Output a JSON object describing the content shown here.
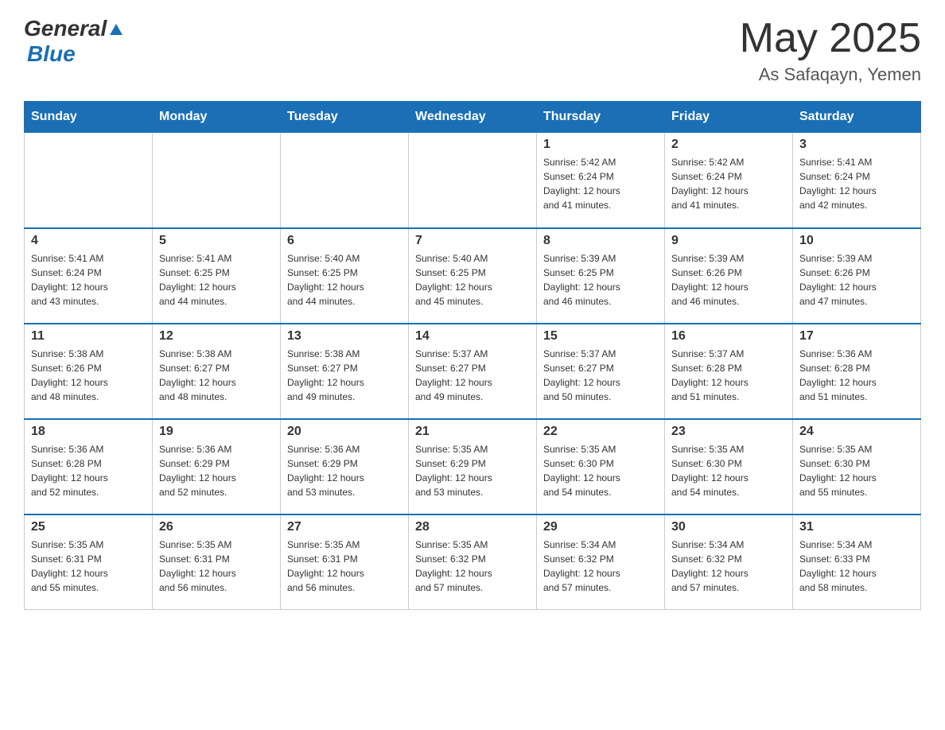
{
  "header": {
    "logo_general": "General",
    "logo_blue": "Blue",
    "month_year": "May 2025",
    "location": "As Safaqayn, Yemen"
  },
  "calendar": {
    "days_of_week": [
      "Sunday",
      "Monday",
      "Tuesday",
      "Wednesday",
      "Thursday",
      "Friday",
      "Saturday"
    ],
    "weeks": [
      [
        {
          "day": "",
          "info": ""
        },
        {
          "day": "",
          "info": ""
        },
        {
          "day": "",
          "info": ""
        },
        {
          "day": "",
          "info": ""
        },
        {
          "day": "1",
          "info": "Sunrise: 5:42 AM\nSunset: 6:24 PM\nDaylight: 12 hours\nand 41 minutes."
        },
        {
          "day": "2",
          "info": "Sunrise: 5:42 AM\nSunset: 6:24 PM\nDaylight: 12 hours\nand 41 minutes."
        },
        {
          "day": "3",
          "info": "Sunrise: 5:41 AM\nSunset: 6:24 PM\nDaylight: 12 hours\nand 42 minutes."
        }
      ],
      [
        {
          "day": "4",
          "info": "Sunrise: 5:41 AM\nSunset: 6:24 PM\nDaylight: 12 hours\nand 43 minutes."
        },
        {
          "day": "5",
          "info": "Sunrise: 5:41 AM\nSunset: 6:25 PM\nDaylight: 12 hours\nand 44 minutes."
        },
        {
          "day": "6",
          "info": "Sunrise: 5:40 AM\nSunset: 6:25 PM\nDaylight: 12 hours\nand 44 minutes."
        },
        {
          "day": "7",
          "info": "Sunrise: 5:40 AM\nSunset: 6:25 PM\nDaylight: 12 hours\nand 45 minutes."
        },
        {
          "day": "8",
          "info": "Sunrise: 5:39 AM\nSunset: 6:25 PM\nDaylight: 12 hours\nand 46 minutes."
        },
        {
          "day": "9",
          "info": "Sunrise: 5:39 AM\nSunset: 6:26 PM\nDaylight: 12 hours\nand 46 minutes."
        },
        {
          "day": "10",
          "info": "Sunrise: 5:39 AM\nSunset: 6:26 PM\nDaylight: 12 hours\nand 47 minutes."
        }
      ],
      [
        {
          "day": "11",
          "info": "Sunrise: 5:38 AM\nSunset: 6:26 PM\nDaylight: 12 hours\nand 48 minutes."
        },
        {
          "day": "12",
          "info": "Sunrise: 5:38 AM\nSunset: 6:27 PM\nDaylight: 12 hours\nand 48 minutes."
        },
        {
          "day": "13",
          "info": "Sunrise: 5:38 AM\nSunset: 6:27 PM\nDaylight: 12 hours\nand 49 minutes."
        },
        {
          "day": "14",
          "info": "Sunrise: 5:37 AM\nSunset: 6:27 PM\nDaylight: 12 hours\nand 49 minutes."
        },
        {
          "day": "15",
          "info": "Sunrise: 5:37 AM\nSunset: 6:27 PM\nDaylight: 12 hours\nand 50 minutes."
        },
        {
          "day": "16",
          "info": "Sunrise: 5:37 AM\nSunset: 6:28 PM\nDaylight: 12 hours\nand 51 minutes."
        },
        {
          "day": "17",
          "info": "Sunrise: 5:36 AM\nSunset: 6:28 PM\nDaylight: 12 hours\nand 51 minutes."
        }
      ],
      [
        {
          "day": "18",
          "info": "Sunrise: 5:36 AM\nSunset: 6:28 PM\nDaylight: 12 hours\nand 52 minutes."
        },
        {
          "day": "19",
          "info": "Sunrise: 5:36 AM\nSunset: 6:29 PM\nDaylight: 12 hours\nand 52 minutes."
        },
        {
          "day": "20",
          "info": "Sunrise: 5:36 AM\nSunset: 6:29 PM\nDaylight: 12 hours\nand 53 minutes."
        },
        {
          "day": "21",
          "info": "Sunrise: 5:35 AM\nSunset: 6:29 PM\nDaylight: 12 hours\nand 53 minutes."
        },
        {
          "day": "22",
          "info": "Sunrise: 5:35 AM\nSunset: 6:30 PM\nDaylight: 12 hours\nand 54 minutes."
        },
        {
          "day": "23",
          "info": "Sunrise: 5:35 AM\nSunset: 6:30 PM\nDaylight: 12 hours\nand 54 minutes."
        },
        {
          "day": "24",
          "info": "Sunrise: 5:35 AM\nSunset: 6:30 PM\nDaylight: 12 hours\nand 55 minutes."
        }
      ],
      [
        {
          "day": "25",
          "info": "Sunrise: 5:35 AM\nSunset: 6:31 PM\nDaylight: 12 hours\nand 55 minutes."
        },
        {
          "day": "26",
          "info": "Sunrise: 5:35 AM\nSunset: 6:31 PM\nDaylight: 12 hours\nand 56 minutes."
        },
        {
          "day": "27",
          "info": "Sunrise: 5:35 AM\nSunset: 6:31 PM\nDaylight: 12 hours\nand 56 minutes."
        },
        {
          "day": "28",
          "info": "Sunrise: 5:35 AM\nSunset: 6:32 PM\nDaylight: 12 hours\nand 57 minutes."
        },
        {
          "day": "29",
          "info": "Sunrise: 5:34 AM\nSunset: 6:32 PM\nDaylight: 12 hours\nand 57 minutes."
        },
        {
          "day": "30",
          "info": "Sunrise: 5:34 AM\nSunset: 6:32 PM\nDaylight: 12 hours\nand 57 minutes."
        },
        {
          "day": "31",
          "info": "Sunrise: 5:34 AM\nSunset: 6:33 PM\nDaylight: 12 hours\nand 58 minutes."
        }
      ]
    ]
  }
}
